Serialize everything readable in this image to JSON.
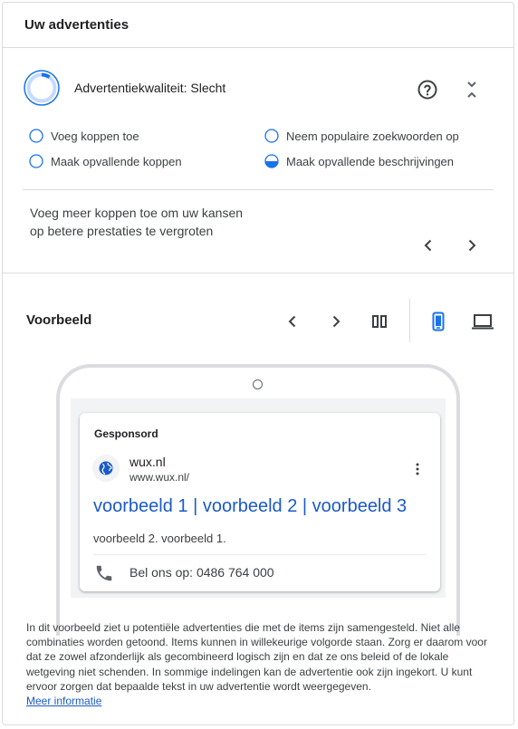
{
  "header": {
    "title": "Uw advertenties"
  },
  "quality": {
    "label": "Advertentiekwaliteit: Slecht",
    "level": 0.1,
    "accent": "#1a73e8"
  },
  "tips": [
    {
      "label": "Voeg koppen toe",
      "state": "empty"
    },
    {
      "label": "Neem populaire zoekwoorden op",
      "state": "empty"
    },
    {
      "label": "Maak opvallende koppen",
      "state": "empty"
    },
    {
      "label": "Maak opvallende beschrijvingen",
      "state": "half"
    }
  ],
  "suggestion": {
    "text": "Voeg meer koppen toe om uw kansen op betere prestaties te vergroten"
  },
  "preview": {
    "title": "Voorbeeld",
    "device_selected": "mobile"
  },
  "ad": {
    "sponsored": "Gesponsord",
    "site_name": "wux.nl",
    "site_url": "www.wux.nl/",
    "headline": "voorbeeld 1 | voorbeeld 2 | voorbeeld 3",
    "description": "voorbeeld 2. voorbeeld 1.",
    "call": "Bel ons op: 0486 764 000"
  },
  "disclaimer": {
    "text": "In dit voorbeeld ziet u potentiële advertenties die met de items zijn samengesteld. Niet alle combinaties worden getoond. Items kunnen in willekeurige volgorde staan. Zorg er daarom voor dat ze zowel afzonderlijk als gecombineerd logisch zijn en dat ze ons beleid of de lokale wetgeving niet schenden. In sommige indelingen kan de advertentie ook zijn ingekort. U kunt ervoor zorgen dat bepaalde tekst in uw advertentie wordt weergegeven.",
    "link": "Meer informatie"
  },
  "icons": {
    "help": "help-circle-icon",
    "collapse": "collapse-icon",
    "prev": "chevron-left-icon",
    "next": "chevron-right-icon",
    "columns": "columns-icon",
    "mobile": "smartphone-icon",
    "desktop": "laptop-icon",
    "globe": "globe-icon",
    "more": "more-vert-icon",
    "phone": "phone-icon"
  },
  "colors": {
    "accent": "#1a73e8",
    "link": "#1a5ac8",
    "border": "#dadce0"
  }
}
